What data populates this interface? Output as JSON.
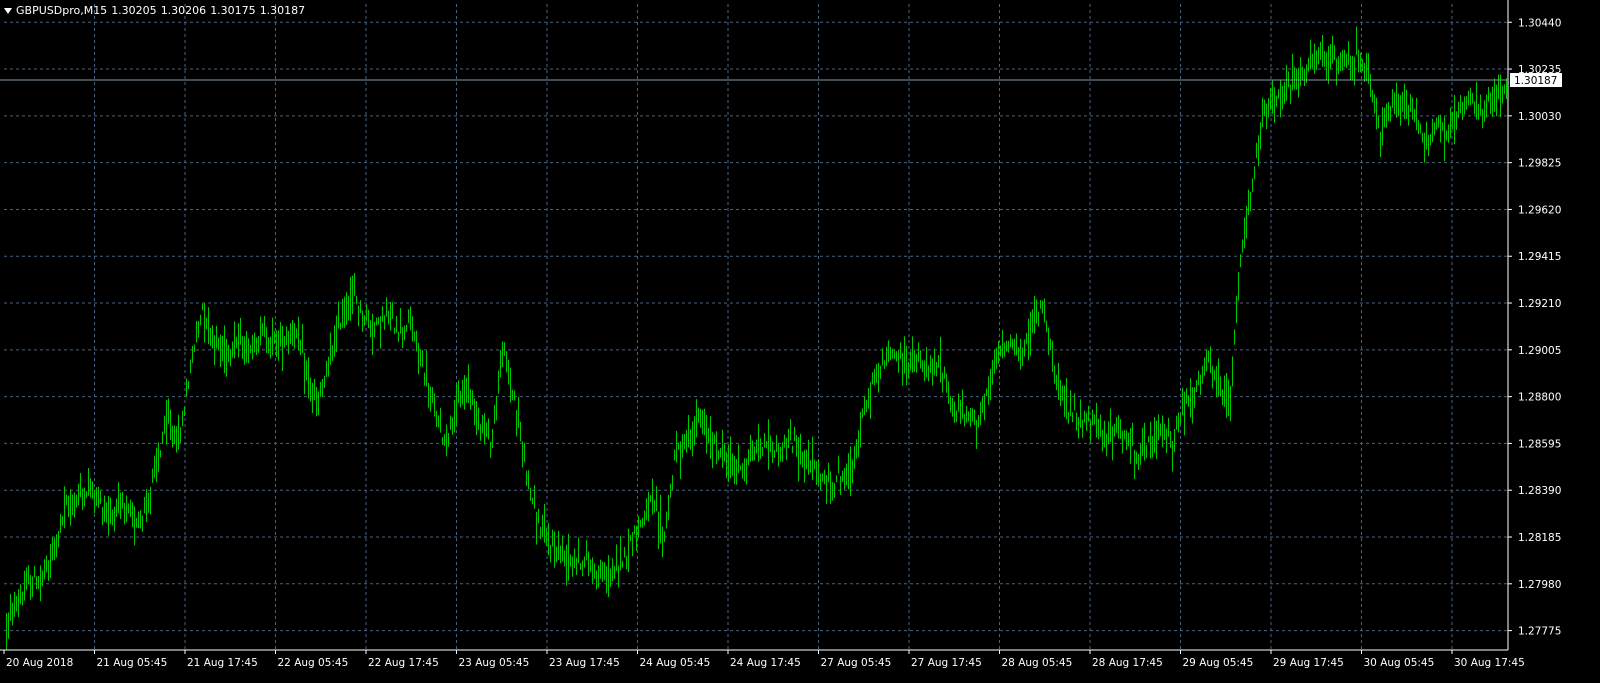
{
  "header": {
    "symbol": "GBPUSDpro,M15",
    "open": "1.30205",
    "high": "1.30206",
    "low": "1.30175",
    "close": "1.30187"
  },
  "colors": {
    "background": "#000000",
    "grid": "#4a6480",
    "bars": "#00c800",
    "axis": "#ffffff",
    "price_line": "#8a9aa8",
    "price_label_bg": "#ffffff",
    "price_label_text": "#000000"
  },
  "chart_data": {
    "type": "line",
    "title": "GBPUSDpro,M15",
    "ylim": [
      1.2769,
      1.3052
    ],
    "grid": true,
    "y_ticks": [
      "1.30440",
      "1.30235",
      "1.30030",
      "1.29825",
      "1.29620",
      "1.29415",
      "1.29210",
      "1.29005",
      "1.28800",
      "1.28595",
      "1.28390",
      "1.28185",
      "1.27980",
      "1.27775"
    ],
    "x_ticks": [
      "20 Aug 2018",
      "21 Aug 05:45",
      "21 Aug 17:45",
      "22 Aug 05:45",
      "22 Aug 17:45",
      "23 Aug 05:45",
      "23 Aug 17:45",
      "24 Aug 05:45",
      "24 Aug 17:45",
      "27 Aug 05:45",
      "27 Aug 17:45",
      "28 Aug 05:45",
      "28 Aug 17:45",
      "29 Aug 05:45",
      "29 Aug 17:45",
      "30 Aug 05:45",
      "30 Aug 17:45"
    ],
    "current_price": "1.30187",
    "series": [
      {
        "values": [
          1.278,
          1.279,
          1.2798,
          1.28,
          1.281,
          1.283,
          1.2835,
          1.284,
          1.2835,
          1.2828,
          1.2832,
          1.2825,
          1.283,
          1.285,
          1.287,
          1.286,
          1.2895,
          1.292,
          1.2905,
          1.29,
          1.2905,
          1.29,
          1.2908,
          1.2905,
          1.2905,
          1.291,
          1.289,
          1.2875,
          1.2895,
          1.2915,
          1.2925,
          1.2915,
          1.291,
          1.2915,
          1.291,
          1.2912,
          1.2895,
          1.2875,
          1.286,
          1.2875,
          1.2885,
          1.287,
          1.286,
          1.29,
          1.288,
          1.285,
          1.2825,
          1.2815,
          1.2812,
          1.281,
          1.2808,
          1.2805,
          1.28,
          1.2805,
          1.2815,
          1.2825,
          1.2835,
          1.2818,
          1.2855,
          1.286,
          1.287,
          1.2862,
          1.2855,
          1.285,
          1.285,
          1.2857,
          1.286,
          1.2855,
          1.286,
          1.2855,
          1.285,
          1.284,
          1.2845,
          1.2845,
          1.2865,
          1.2885,
          1.2895,
          1.29,
          1.2895,
          1.2895,
          1.289,
          1.2895,
          1.2875,
          1.2872,
          1.287,
          1.288,
          1.29,
          1.2905,
          1.2895,
          1.2915,
          1.292,
          1.2885,
          1.2875,
          1.287,
          1.2868,
          1.2865,
          1.2865,
          1.2862,
          1.2855,
          1.2858,
          1.2865,
          1.286,
          1.2875,
          1.288,
          1.2895,
          1.2885,
          1.2875,
          1.294,
          1.2975,
          1.3005,
          1.301,
          1.3015,
          1.302,
          1.3025,
          1.303,
          1.3025,
          1.303,
          1.3028,
          1.302,
          1.2995,
          1.3005,
          1.301,
          1.3005,
          1.299,
          1.3,
          1.2995,
          1.3005,
          1.3008,
          1.3005,
          1.301,
          1.3018
        ]
      }
    ]
  }
}
